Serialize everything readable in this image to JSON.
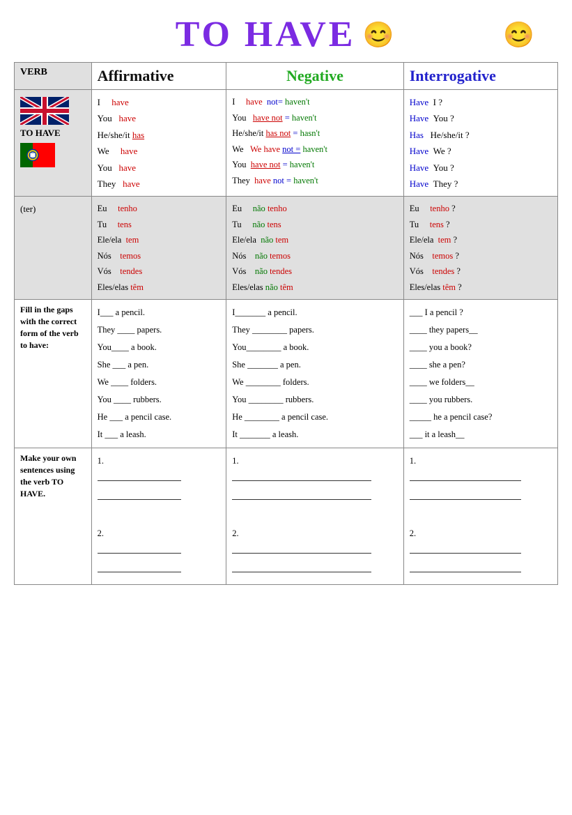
{
  "title": "TO HAVE",
  "emoji_middle": "😊",
  "emoji_right": "😊",
  "headers": {
    "verb": "VERB",
    "affirmative": "Affirmative",
    "negative": "Negative",
    "interrogative": "Interrogative"
  },
  "verb_section": {
    "to_have": "TO HAVE",
    "ter": "(ter)"
  },
  "affirmative_en": [
    {
      "subject": "I",
      "verb": "have"
    },
    {
      "subject": "You",
      "verb": "have"
    },
    {
      "subject": "He/she/it",
      "verb": "has"
    },
    {
      "subject": "We",
      "verb": "have"
    },
    {
      "subject": "You",
      "verb": "have"
    },
    {
      "subject": "They",
      "verb": "have"
    }
  ],
  "negative_en": [
    {
      "subject": "I",
      "verb": "have",
      "not": "not=",
      "contraction": "haven't"
    },
    {
      "subject": "You",
      "verb": "have not",
      "eq": "=",
      "contraction": "haven't"
    },
    {
      "subject": "He/she/it",
      "verb": "has not",
      "eq": "=",
      "contraction": "hasn't"
    },
    {
      "subject": "We",
      "verb": "have",
      "not": "not =",
      "contraction": "haven't"
    },
    {
      "subject": "You",
      "verb": "have not",
      "eq": "=",
      "contraction": "haven't"
    },
    {
      "subject": "They",
      "verb": "have",
      "not": "not =",
      "contraction": "haven't"
    }
  ],
  "interrogative_en": [
    {
      "aux": "Have",
      "subject": "I",
      "mark": "?"
    },
    {
      "aux": "Have",
      "subject": "You",
      "mark": "?"
    },
    {
      "aux": "Has",
      "subject": "He/she/it",
      "mark": "?"
    },
    {
      "aux": "Have",
      "subject": "We",
      "mark": "?"
    },
    {
      "aux": "Have",
      "subject": "You",
      "mark": "?"
    },
    {
      "aux": "Have",
      "subject": "They",
      "mark": "?"
    }
  ],
  "affirmative_pt": [
    {
      "subject": "Eu",
      "verb": "tenho"
    },
    {
      "subject": "Tu",
      "verb": "tens"
    },
    {
      "subject": "Ele/ela",
      "verb": "tem"
    },
    {
      "subject": "Nós",
      "verb": "temos"
    },
    {
      "subject": "Vós",
      "verb": "tendes"
    },
    {
      "subject": "Eles/elas",
      "verb": "têm"
    }
  ],
  "negative_pt": [
    {
      "subject": "Eu",
      "neg": "não",
      "verb": "tenho"
    },
    {
      "subject": "Tu",
      "neg": "não",
      "verb": "tens"
    },
    {
      "subject": "Ele/ela",
      "neg": "não",
      "verb": "tem"
    },
    {
      "subject": "Nós",
      "neg": "não",
      "verb": "temos"
    },
    {
      "subject": "Vós",
      "neg": "não",
      "verb": "tendes"
    },
    {
      "subject": "Eles/elas",
      "neg": "não",
      "verb": "têm"
    }
  ],
  "interrogative_pt": [
    {
      "subject": "Eu",
      "verb": "tenho",
      "mark": "?"
    },
    {
      "subject": "Tu",
      "verb": "tens",
      "mark": "?"
    },
    {
      "subject": "Ele/ela",
      "verb": "tem",
      "mark": "?"
    },
    {
      "subject": "Nós",
      "verb": "temos",
      "mark": "?"
    },
    {
      "subject": "Vós",
      "verb": "tendes",
      "mark": "?"
    },
    {
      "subject": "Eles/elas",
      "verb": "têm",
      "mark": "?"
    }
  ],
  "fill_label": "Fill in the gaps with the correct form of the verb to have:",
  "fill_affirmative": [
    "I___ a pencil.",
    "They ____ papers.",
    "You____ a book.",
    "She ___ a pen.",
    "We ____ folders.",
    "You ____ rubbers.",
    "He ___ a pencil case.",
    "It ___ a leash."
  ],
  "fill_negative": [
    "I_______ a pencil.",
    "They ________ papers.",
    "You________ a book.",
    "She _______ a pen.",
    "We ________ folders.",
    "You ________ rubbers.",
    "He ________ a pencil case.",
    "It _______ a leash."
  ],
  "fill_interrogative": [
    "___ I a pencil ?",
    "____ they papers__",
    "____ you a book?",
    "____ she a pen?",
    "____ we folders__",
    "____ you rubbers.",
    "_____ he a pencil case?",
    "___ it a leash__"
  ],
  "make_label": "Make your own sentences using the verb TO HAVE.",
  "make_numbers": [
    "1.",
    "2."
  ],
  "colors": {
    "title": "#7b2be2",
    "affirmative_verb": "#cc0000",
    "negative_label": "#22aa22",
    "interrogative_label": "#2222cc",
    "pt_verb": "#cc0000",
    "pt_neg": "#22aa22"
  }
}
